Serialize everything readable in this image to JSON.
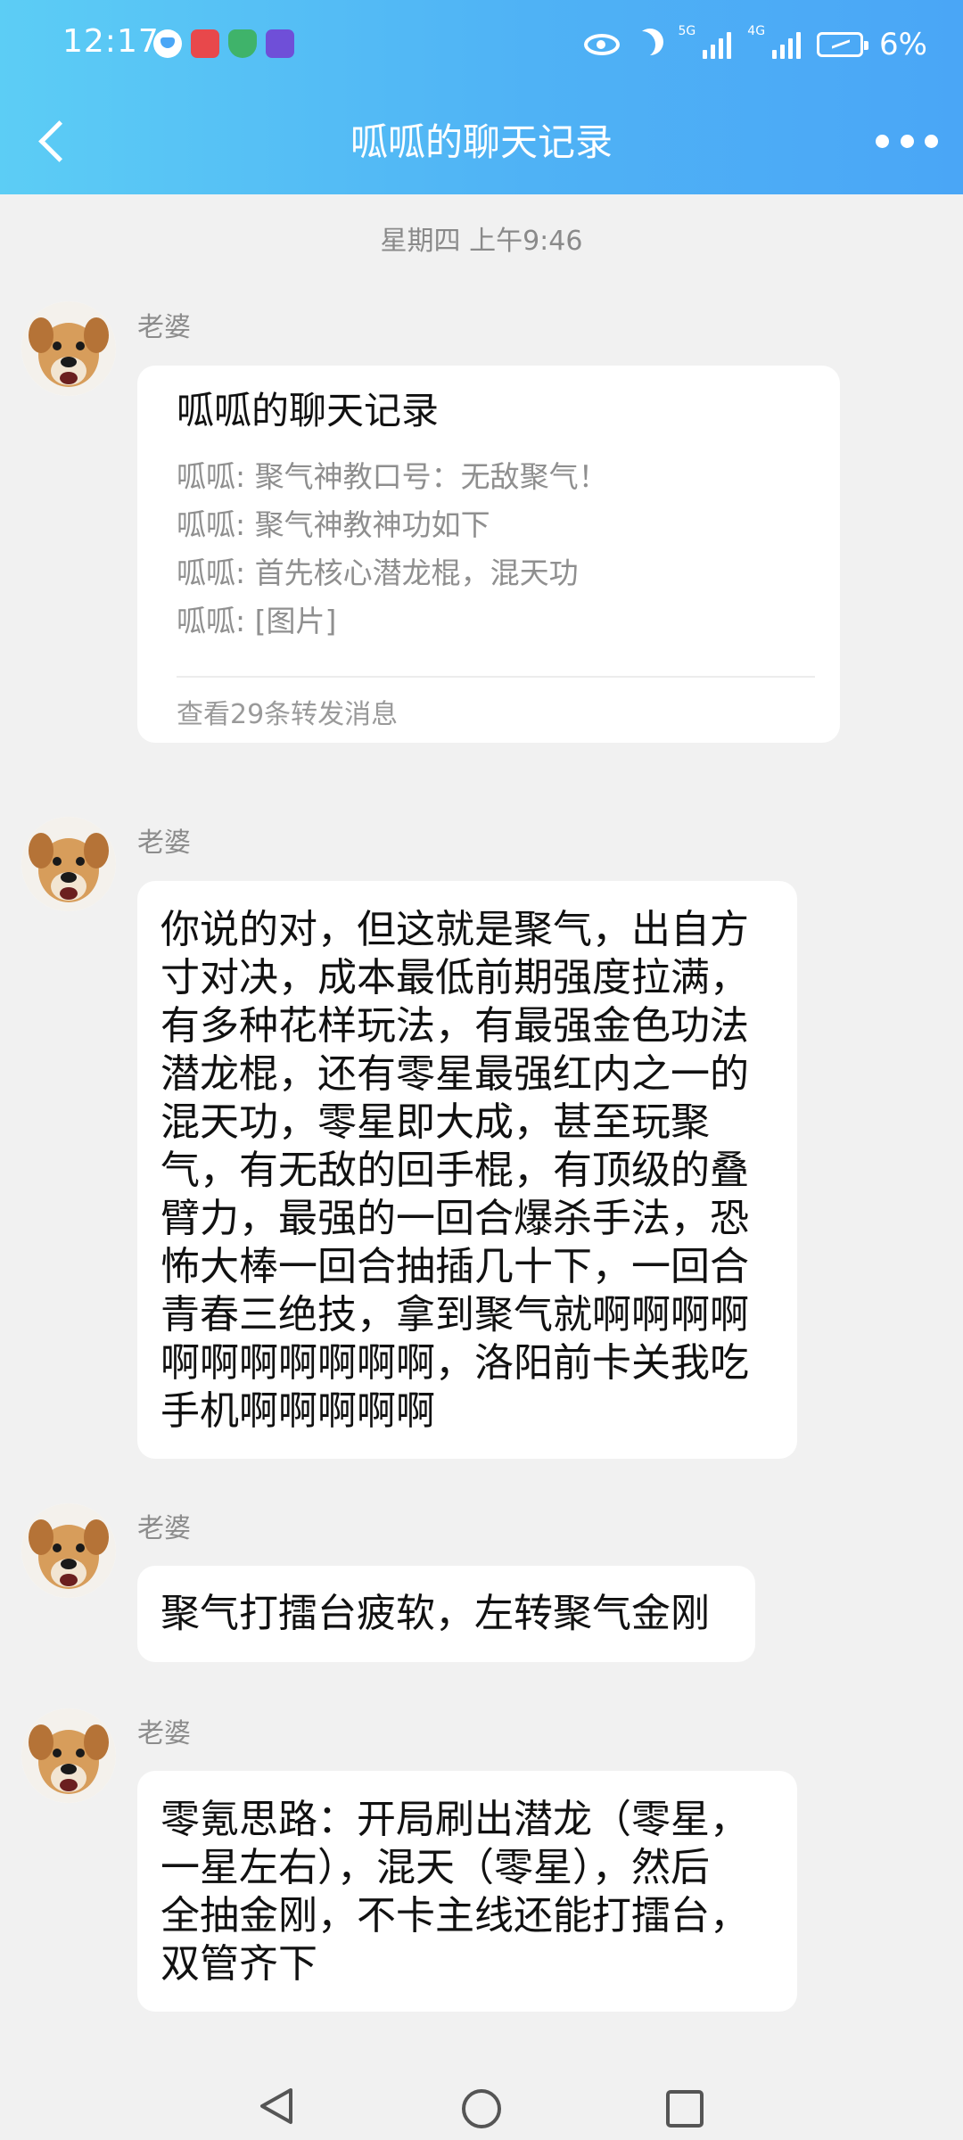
{
  "status_bar": {
    "time": "12:17",
    "battery": "6%",
    "net1": "5G",
    "net2": "4G",
    "icons": [
      "heart-icon",
      "app-red-icon",
      "shield-icon",
      "graduation-icon",
      "eye-icon",
      "moon-icon",
      "signal-icon",
      "battery-charging-icon"
    ]
  },
  "nav": {
    "title": "呱呱的聊天记录",
    "back_icon": "chevron-left-icon",
    "more_icon": "more-dots-icon"
  },
  "chat": {
    "timestamp": "星期四 上午9:46",
    "messages": [
      {
        "sender": "老婆",
        "type": "forward-card",
        "title": "呱呱的聊天记录",
        "lines": [
          "呱呱: 聚气神教口号：无敌聚气！",
          "呱呱: 聚气神教神功如下",
          "呱呱: 首先核心潜龙棍，混天功",
          "呱呱: [图片]"
        ],
        "footer": "查看29条转发消息"
      },
      {
        "sender": "老婆",
        "type": "text",
        "lines": [
          "你说的对，但这就是聚气，出自方",
          "寸对决，成本最低前期强度拉满，",
          "有多种花样玩法，有最强金色功法",
          "潜龙棍，还有零星最强红内之一的",
          "混天功，零星即大成，甚至玩聚",
          "气，有无敌的回手棍，有顶级的叠",
          "臂力，最强的一回合爆杀手法，恐",
          "怖大棒一回合抽插几十下，一回合",
          "青春三绝技，拿到聚气就啊啊啊啊",
          "啊啊啊啊啊啊啊，洛阳前卡关我吃",
          "手机啊啊啊啊啊"
        ]
      },
      {
        "sender": "老婆",
        "type": "text",
        "lines": [
          "聚气打擂台疲软，左转聚气金刚"
        ]
      },
      {
        "sender": "老婆",
        "type": "text",
        "lines": [
          "零氪思路：开局刷出潜龙（零星，",
          "一星左右），混天（零星），然后",
          "全抽金刚，不卡主线还能打擂台，",
          "双管齐下"
        ]
      }
    ]
  },
  "system_nav": {
    "icons": [
      "back-triangle-icon",
      "home-circle-icon",
      "recents-square-icon"
    ]
  },
  "colors": {
    "header_gradient_start": "#5ccdf5",
    "header_gradient_end": "#4aa6f6",
    "chat_background": "#f1f1f1",
    "bubble": "#ffffff"
  }
}
